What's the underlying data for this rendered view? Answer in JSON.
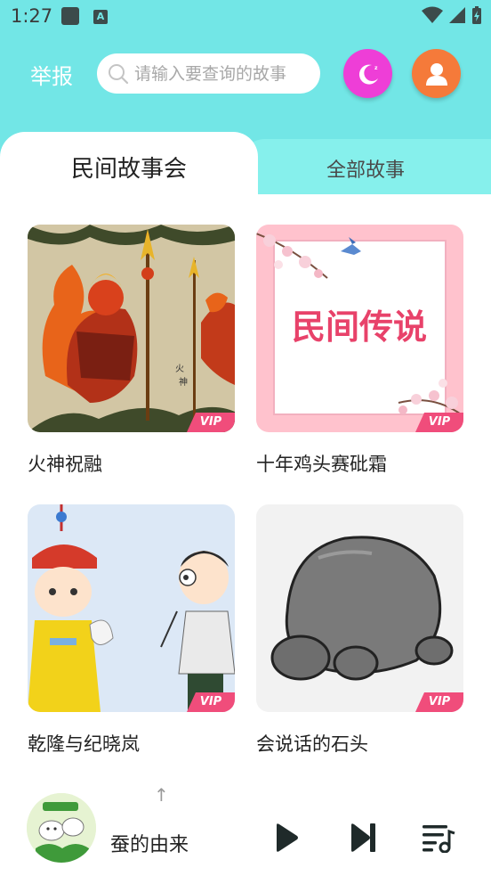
{
  "status_bar": {
    "time": "1:27",
    "a_glyph": "A"
  },
  "header": {
    "report_label": "举报",
    "search_placeholder": "请输入要查询的故事",
    "night_icon": "moon-icon",
    "user_icon": "user-icon",
    "colors": {
      "bg": "#72e6e6",
      "night": "#ee3ed7",
      "user": "#f57a3a"
    }
  },
  "tabs": [
    {
      "label": "民间故事会",
      "active": true
    },
    {
      "label": "全部故事",
      "active": false
    }
  ],
  "stories": [
    {
      "title": "火神祝融",
      "badge": "VIP"
    },
    {
      "title": "十年鸡头赛砒霜",
      "badge": "VIP",
      "cover_text": "民间传说"
    },
    {
      "title": "乾隆与纪晓岚",
      "badge": "VIP"
    },
    {
      "title": "会说话的石头",
      "badge": "VIP"
    }
  ],
  "player": {
    "now_playing": "蚕的由来",
    "expand_glyph": "↑",
    "controls": [
      "play-icon",
      "next-icon",
      "playlist-icon"
    ],
    "accent": "#f04d7b"
  }
}
